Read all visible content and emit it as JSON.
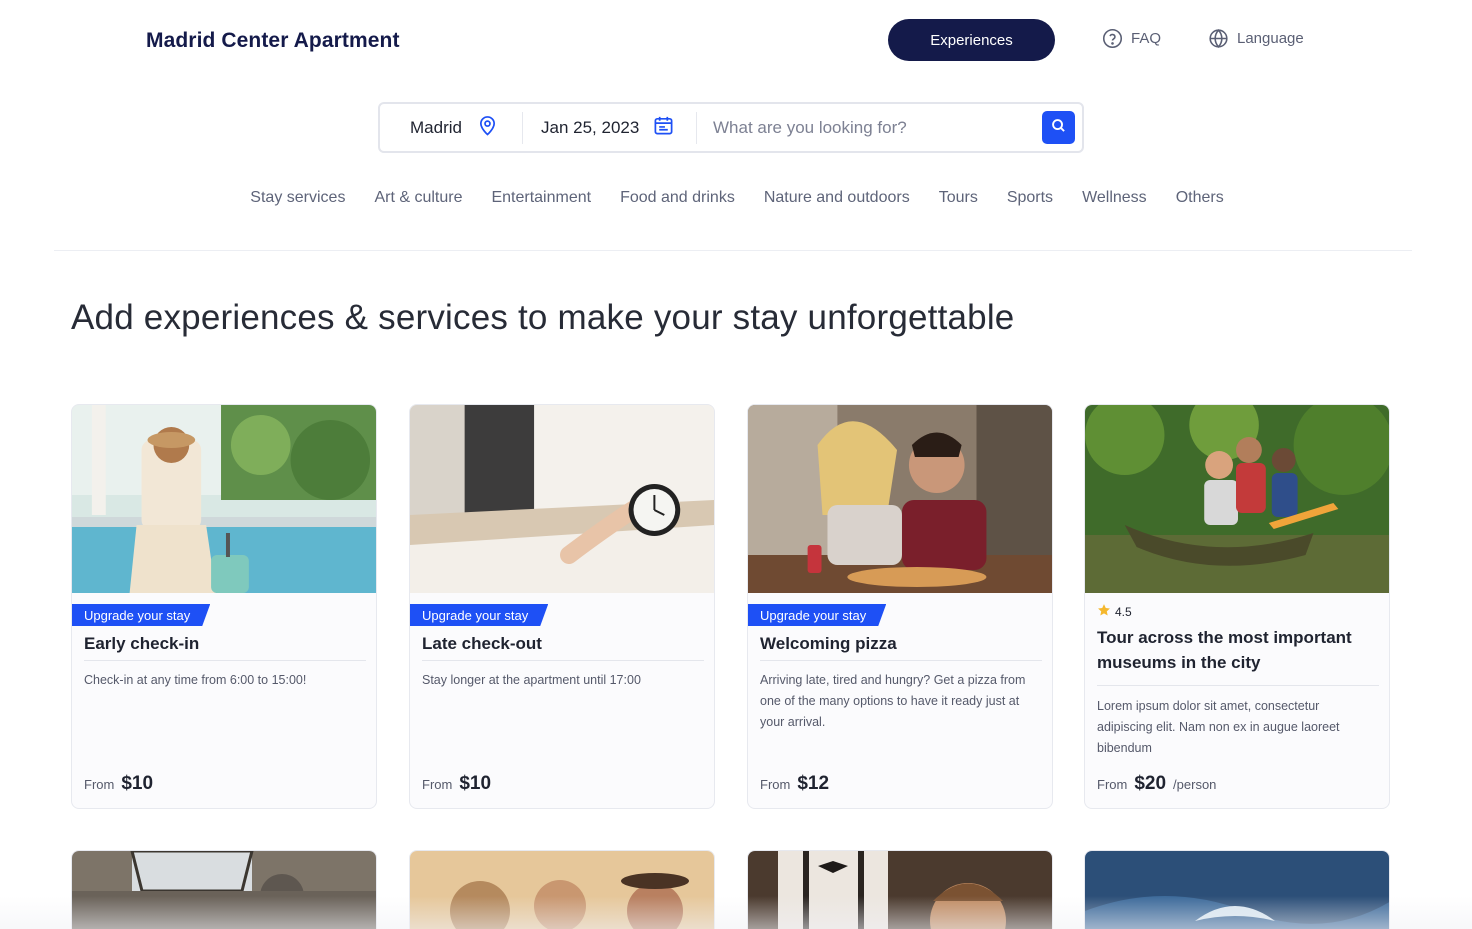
{
  "brand": "Madrid Center Apartment",
  "nav": {
    "experiences_label": "Experiences",
    "faq_label": "FAQ",
    "language_label": "Language"
  },
  "search": {
    "city": "Madrid",
    "date": "Jan 25, 2023",
    "placeholder": "What are you looking for?"
  },
  "categories": [
    "Stay services",
    "Art & culture",
    "Entertainment",
    "Food and drinks",
    "Nature and outdoors",
    "Tours",
    "Sports",
    "Wellness",
    "Others"
  ],
  "headline": "Add experiences & services to make your stay unforgettable",
  "cards": [
    {
      "tag": "Upgrade your stay",
      "title": "Early check-in",
      "description": "Check-in at any time from 6:00 to 15:00!",
      "price_from": "From",
      "price": "$10",
      "image": "woman-by-pool-with-suitcase"
    },
    {
      "tag": "Upgrade your stay",
      "title": "Late check-out",
      "description": "Stay longer at the apartment until 17:00",
      "price_from": "From",
      "price": "$10",
      "image": "hand-with-alarm-clock"
    },
    {
      "tag": "Upgrade your stay",
      "title": "Welcoming pizza",
      "description": "Arriving late, tired and hungry? Get a pizza from one of the many options to have it ready just at your arrival.",
      "price_from": "From",
      "price": "$12",
      "image": "couple-eating-pizza"
    },
    {
      "rating": "4.5",
      "title": "Tour across the most important museums in the city",
      "description": "Lorem ipsum dolor sit amet, consectetur adipiscing elit. Nam non ex in augue laoreet bibendum",
      "price_from": "From",
      "price": "$20",
      "price_unit": "/person",
      "image": "people-in-canoe"
    }
  ],
  "more_cards": [
    "ornate-ceiling-interior",
    "friends-smiling-outdoors",
    "barber-with-suspenders",
    "water-splash"
  ],
  "colors": {
    "navy": "#141a4a",
    "accent": "#1e50f5",
    "star": "#f5b82e"
  }
}
